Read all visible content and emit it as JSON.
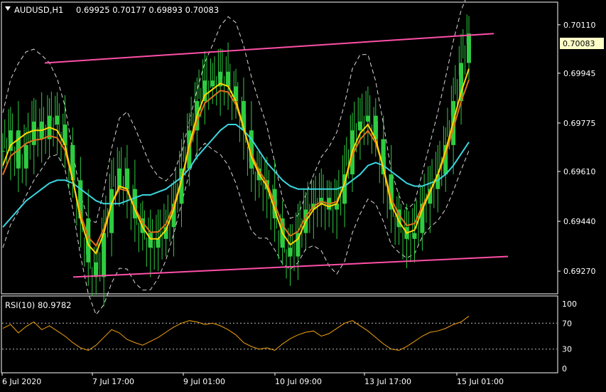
{
  "header": {
    "symbol": "AUDUSD,H1",
    "ohlc": "0.69925 0.70177 0.69893 0.70083"
  },
  "rsi_header": "RSI(10) 80.9782",
  "colors": {
    "background": "#000000",
    "frame": "#ffffff",
    "candles": "#2ecc40",
    "ma_fast": "#ffd600",
    "ma_mid": "#e2731b",
    "ma_slow": "#3bd6e0",
    "bands": "#ffffff",
    "channel": "#ff4fa8",
    "rsi_line": "#f0a010",
    "price_tag_bg": "#ffffc8"
  },
  "chart_data": [
    {
      "type": "line",
      "title": "AUDUSD,H1",
      "x_tick_labels": [
        "6 Jul 2020",
        "7 Jul 17:00",
        "9 Jul 01:00",
        "10 Jul 09:00",
        "13 Jul 17:00",
        "15 Jul 01:00"
      ],
      "y_tick_labels": [
        "0.70110",
        "0.69945",
        "0.69775",
        "0.69610",
        "0.69440",
        "0.69270"
      ],
      "ylim": [
        0.692,
        0.7018
      ],
      "current_price": "0.70083",
      "series": [
        {
          "role": "close",
          "values": [
            0.6968,
            0.6975,
            0.6962,
            0.697,
            0.6978,
            0.6972,
            0.698,
            0.6977,
            0.697,
            0.6958,
            0.6945,
            0.693,
            0.6925,
            0.694,
            0.6955,
            0.6962,
            0.6955,
            0.6945,
            0.694,
            0.6935,
            0.6938,
            0.6942,
            0.695,
            0.6962,
            0.6975,
            0.6985,
            0.6992,
            0.699,
            0.6995,
            0.699,
            0.6985,
            0.6975,
            0.6962,
            0.6958,
            0.6955,
            0.6945,
            0.6935,
            0.6932,
            0.694,
            0.6948,
            0.695,
            0.6952,
            0.6948,
            0.695,
            0.696,
            0.6975,
            0.6978,
            0.698,
            0.6972,
            0.696,
            0.6948,
            0.6942,
            0.6938,
            0.694,
            0.695,
            0.6955,
            0.696,
            0.697,
            0.6985,
            0.6998,
            0.7008
          ]
        },
        {
          "role": "ma_fast",
          "values": [
            0.6963,
            0.697,
            0.6972,
            0.6974,
            0.6975,
            0.6975,
            0.6976,
            0.6975,
            0.697,
            0.6958,
            0.6945,
            0.6936,
            0.6933,
            0.694,
            0.695,
            0.6956,
            0.6955,
            0.6948,
            0.6942,
            0.6938,
            0.6938,
            0.6941,
            0.6948,
            0.6958,
            0.697,
            0.698,
            0.6987,
            0.6989,
            0.6991,
            0.699,
            0.6985,
            0.6976,
            0.6966,
            0.696,
            0.6956,
            0.6948,
            0.694,
            0.6936,
            0.6938,
            0.6944,
            0.6948,
            0.695,
            0.6949,
            0.695,
            0.6957,
            0.6968,
            0.6974,
            0.6977,
            0.6972,
            0.6962,
            0.695,
            0.6944,
            0.694,
            0.6941,
            0.6948,
            0.6954,
            0.696,
            0.6968,
            0.6978,
            0.6988,
            0.6996
          ]
        },
        {
          "role": "ma_slow",
          "values": [
            0.6942,
            0.6945,
            0.6948,
            0.6951,
            0.6953,
            0.6955,
            0.6957,
            0.6958,
            0.6958,
            0.6957,
            0.6955,
            0.6953,
            0.6951,
            0.695,
            0.695,
            0.695,
            0.6951,
            0.6952,
            0.6953,
            0.6953,
            0.6954,
            0.6955,
            0.6957,
            0.6959,
            0.6962,
            0.6966,
            0.6969,
            0.6972,
            0.6975,
            0.6977,
            0.6977,
            0.6975,
            0.6972,
            0.6968,
            0.6964,
            0.6961,
            0.6958,
            0.6956,
            0.6955,
            0.6955,
            0.6955,
            0.6955,
            0.6955,
            0.6955,
            0.6956,
            0.6958,
            0.696,
            0.6963,
            0.6964,
            0.6963,
            0.6961,
            0.6959,
            0.6957,
            0.6956,
            0.6956,
            0.6957,
            0.6958,
            0.696,
            0.6963,
            0.6967,
            0.6971
          ]
        },
        {
          "role": "channel_upper",
          "values": [
            0.6998,
            0.7008
          ]
        },
        {
          "role": "channel_lower",
          "values": [
            0.6925,
            0.6932
          ]
        }
      ]
    },
    {
      "type": "line",
      "title": "RSI(10) 80.9782",
      "y_tick_labels": [
        "100",
        "70",
        "30",
        "0"
      ],
      "levels": [
        70,
        30
      ],
      "ylim": [
        0,
        100
      ],
      "series": [
        {
          "role": "rsi",
          "values": [
            62,
            68,
            55,
            65,
            72,
            60,
            66,
            58,
            50,
            40,
            32,
            28,
            36,
            48,
            60,
            55,
            45,
            40,
            36,
            42,
            48,
            56,
            64,
            70,
            74,
            72,
            68,
            70,
            66,
            60,
            52,
            40,
            34,
            30,
            32,
            28,
            38,
            46,
            52,
            56,
            58,
            50,
            54,
            62,
            70,
            74,
            66,
            58,
            48,
            38,
            30,
            28,
            34,
            42,
            50,
            56,
            58,
            62,
            68,
            72,
            81
          ]
        }
      ]
    }
  ]
}
